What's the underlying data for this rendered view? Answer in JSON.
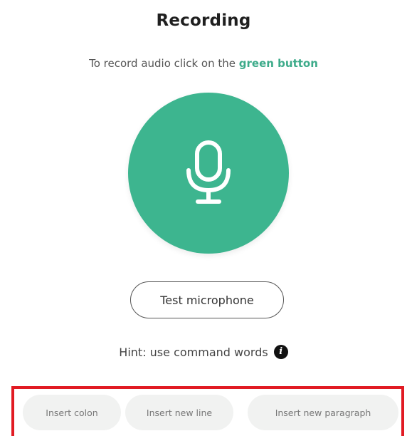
{
  "header": {
    "title": "Recording"
  },
  "instructions": {
    "prefix": "To record audio click on the ",
    "accent": "green button"
  },
  "record": {
    "icon": "microphone-icon",
    "color": "#3db58f"
  },
  "test_button": {
    "label": "Test microphone"
  },
  "hint": {
    "text": "Hint: use command words",
    "icon": "info-icon",
    "icon_glyph": "i"
  },
  "commands": [
    {
      "label": "Insert colon"
    },
    {
      "label": "Insert new line"
    },
    {
      "label": "Insert new paragraph"
    }
  ],
  "colors": {
    "accent": "#3dab8a",
    "highlight_border": "#e11b23",
    "chip_bg": "#f1f2f1"
  }
}
